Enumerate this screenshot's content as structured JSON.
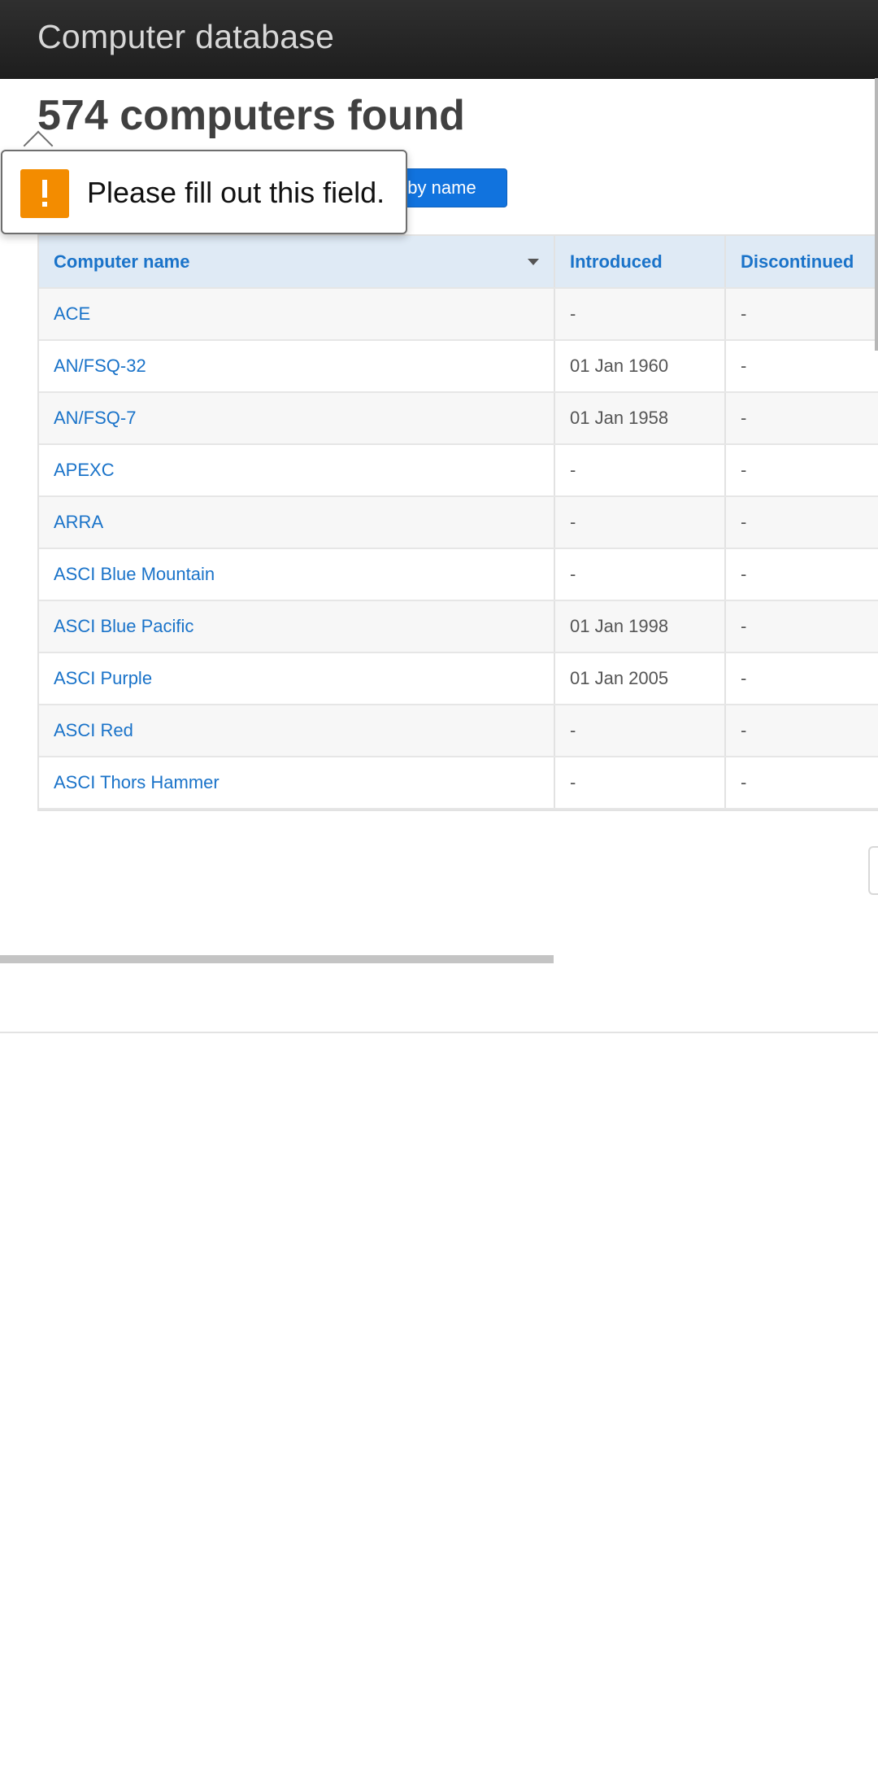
{
  "header": {
    "app_title": "Computer database"
  },
  "main": {
    "results_heading": "574 computers found",
    "filter": {
      "placeholder": "",
      "value": "",
      "button_label": "Filter by name"
    },
    "validation_tooltip": {
      "message": "Please fill out this field.",
      "icon": "warning-exclamation-icon",
      "icon_color": "#f38c00"
    },
    "table": {
      "columns": [
        "Computer name",
        "Introduced",
        "Discontinued"
      ],
      "sorted_column": "Computer name",
      "rows": [
        {
          "name": "ACE",
          "introduced": "-",
          "discontinued": "-"
        },
        {
          "name": "AN/FSQ-32",
          "introduced": "01 Jan 1960",
          "discontinued": "-"
        },
        {
          "name": "AN/FSQ-7",
          "introduced": "01 Jan 1958",
          "discontinued": "-"
        },
        {
          "name": "APEXC",
          "introduced": "-",
          "discontinued": "-"
        },
        {
          "name": "ARRA",
          "introduced": "-",
          "discontinued": "-"
        },
        {
          "name": "ASCI Blue Mountain",
          "introduced": "-",
          "discontinued": "-"
        },
        {
          "name": "ASCI Blue Pacific",
          "introduced": "01 Jan 1998",
          "discontinued": "-"
        },
        {
          "name": "ASCI Purple",
          "introduced": "01 Jan 2005",
          "discontinued": "-"
        },
        {
          "name": "ASCI Red",
          "introduced": "-",
          "discontinued": "-"
        },
        {
          "name": "ASCI Thors Hammer",
          "introduced": "-",
          "discontinued": "-"
        }
      ]
    }
  },
  "colors": {
    "header_bg": "#262626",
    "link": "#1a73c9",
    "primary_button": "#1173de",
    "table_header_bg": "#dfeaf5"
  }
}
